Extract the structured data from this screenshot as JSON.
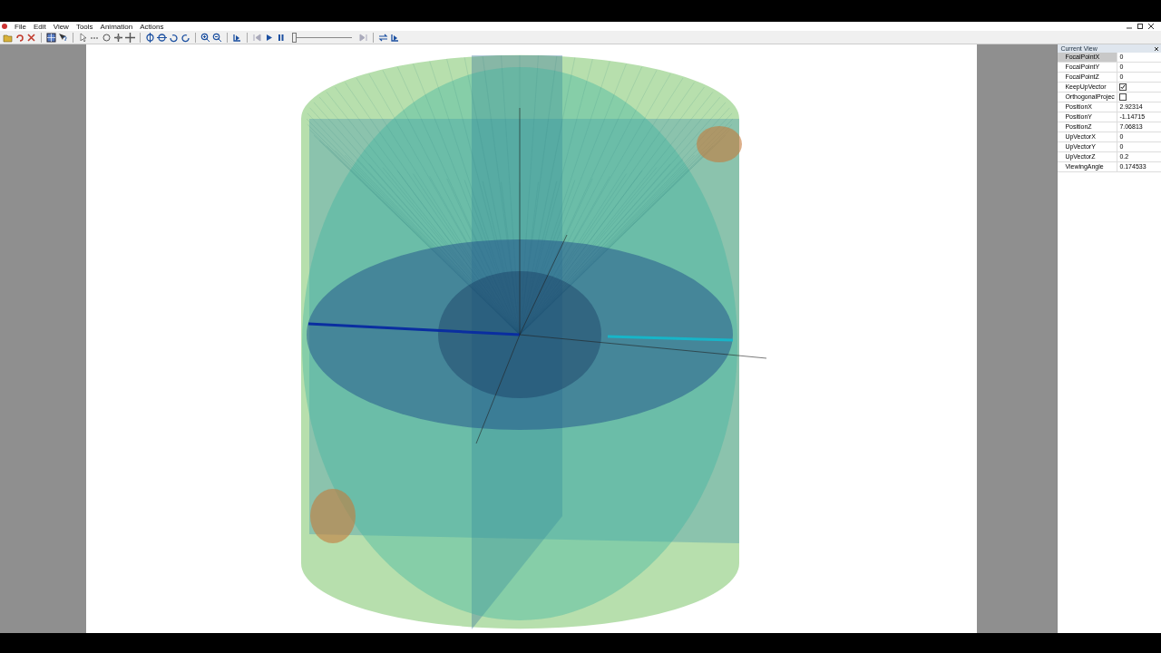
{
  "menu": [
    "File",
    "Edit",
    "View",
    "Tools",
    "Animation",
    "Actions"
  ],
  "toolbar": {
    "timeline": {
      "level": 0.0
    }
  },
  "properties": {
    "title": "Current View",
    "rows": [
      {
        "name": "FocalPointX",
        "value": "0",
        "kind": "text",
        "selected": true
      },
      {
        "name": "FocalPointY",
        "value": "0",
        "kind": "text",
        "selected": false
      },
      {
        "name": "FocalPointZ",
        "value": "0",
        "kind": "text",
        "selected": false
      },
      {
        "name": "KeepUpVector",
        "kind": "check",
        "checked": true,
        "selected": false
      },
      {
        "name": "OrthogonalProjec",
        "kind": "check",
        "checked": false,
        "selected": false
      },
      {
        "name": "PositionX",
        "value": "2.92314",
        "kind": "text",
        "selected": false
      },
      {
        "name": "PositionY",
        "value": "-1.14715",
        "kind": "text",
        "selected": false
      },
      {
        "name": "PositionZ",
        "value": "7.06813",
        "kind": "text",
        "selected": false
      },
      {
        "name": "UpVectorX",
        "value": "0",
        "kind": "text",
        "selected": false
      },
      {
        "name": "UpVectorY",
        "value": "0",
        "kind": "text",
        "selected": false
      },
      {
        "name": "UpVectorZ",
        "value": "0.2",
        "kind": "text",
        "selected": false
      },
      {
        "name": "ViewingAngle",
        "value": "0.174533",
        "kind": "text",
        "selected": false
      }
    ]
  }
}
